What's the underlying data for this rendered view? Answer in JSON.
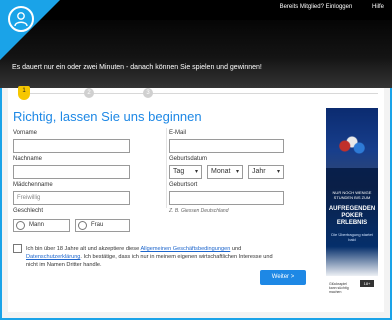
{
  "topbar": {
    "login_prompt": "Bereits Mitglied? Einloggen",
    "help": "Hilfe"
  },
  "hero": {
    "tagline": "Es dauert nur ein oder zwei Minuten - danach können Sie spielen und gewinnen!"
  },
  "steps": [
    "1",
    "2",
    "3"
  ],
  "form": {
    "title": "Richtig, lassen Sie uns beginnen",
    "first_name_label": "Vorname",
    "last_name_label": "Nachname",
    "maiden_label": "Mädchenname",
    "maiden_placeholder": "Freiwillig",
    "gender_label": "Geschlecht",
    "male": "Mann",
    "female": "Frau",
    "email_label": "E-Mail",
    "dob_label": "Geburtsdatum",
    "day": "Tag",
    "month": "Monat",
    "year": "Jahr",
    "birthplace_label": "Geburtsort",
    "birthplace_hint": "Z. B. Giessen Deutschland",
    "terms_prefix": "Ich bin über 18 Jahre alt und akzeptiere diese ",
    "terms_link": "Allgemeinen Geschäftsbedingungen",
    "terms_mid": " und ",
    "privacy_link": "Datenschutzerklärung",
    "terms_suffix": ". Ich bestätige, dass ich nur in meinem eigenen wirtschaftlichen Interesse und nicht im Namen Dritter handle.",
    "next_button": "Weiter >"
  },
  "ad": {
    "line1": "NUR NOCH WENIGE STUNDEN BIS ZUM",
    "headline": "AUFREGENDEN POKER ERLEBNIS",
    "line3": "Die Übertragung startet bald",
    "footer": "Glücksspiel kann süchtig machen",
    "badge": "18+"
  },
  "colors": {
    "accent": "#1e88e5",
    "frame": "#1aa3e8",
    "step_active": "#f6c700"
  }
}
